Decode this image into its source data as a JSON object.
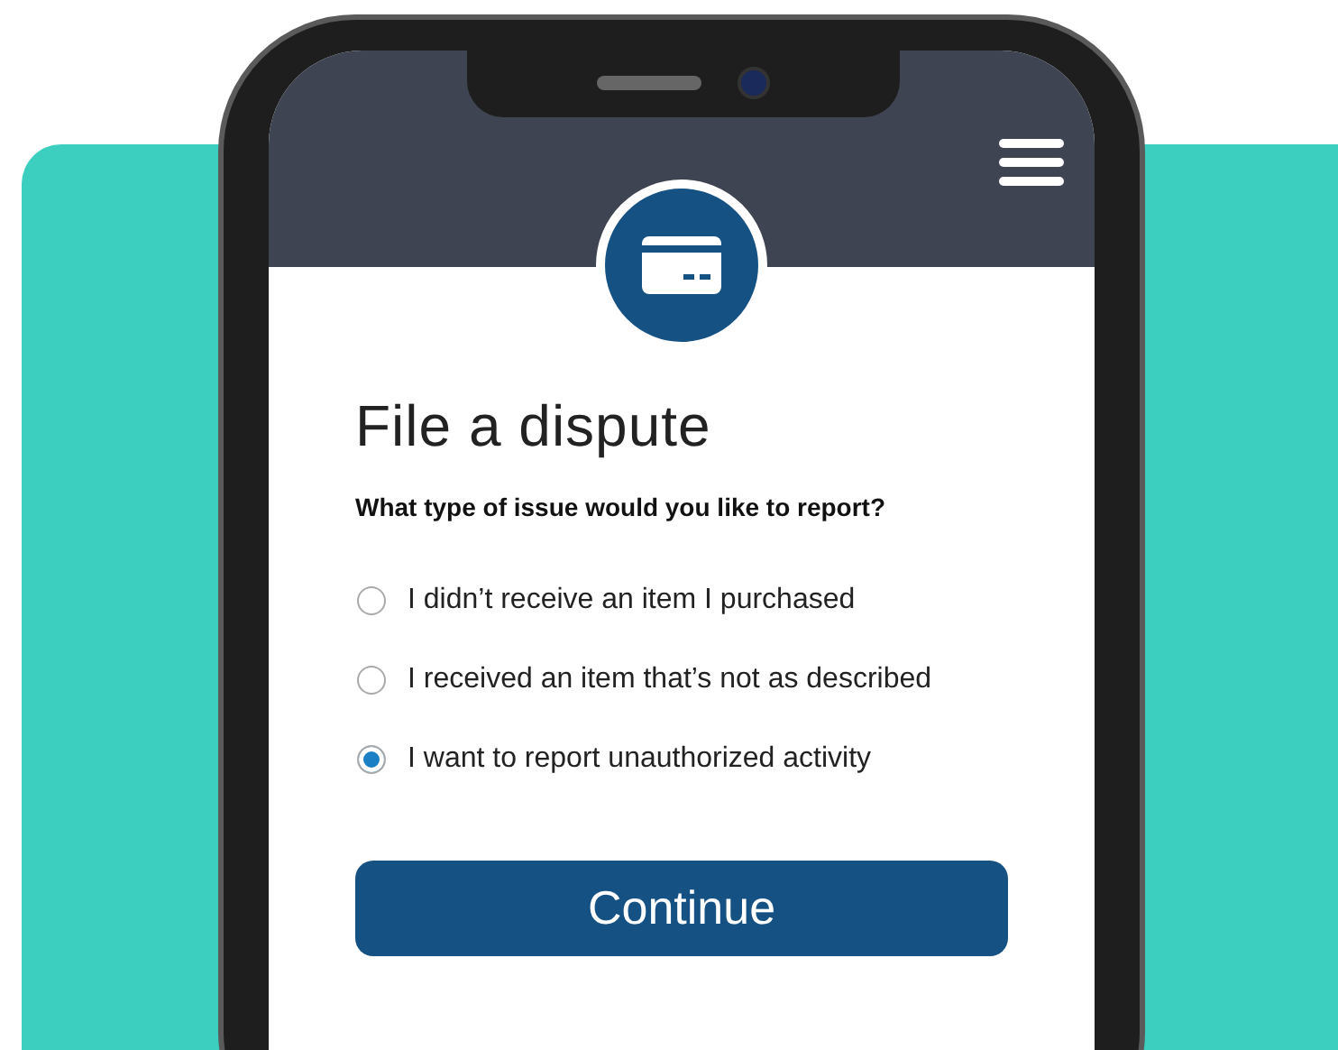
{
  "screen": {
    "title": "File a dispute",
    "question": "What type of issue would you like to report?",
    "options": [
      {
        "label": "I didn’t receive an item I purchased",
        "selected": false
      },
      {
        "label": "I received an item that’s not as described",
        "selected": false
      },
      {
        "label": "I want to report unauthorized activity",
        "selected": true
      }
    ],
    "button": "Continue"
  }
}
